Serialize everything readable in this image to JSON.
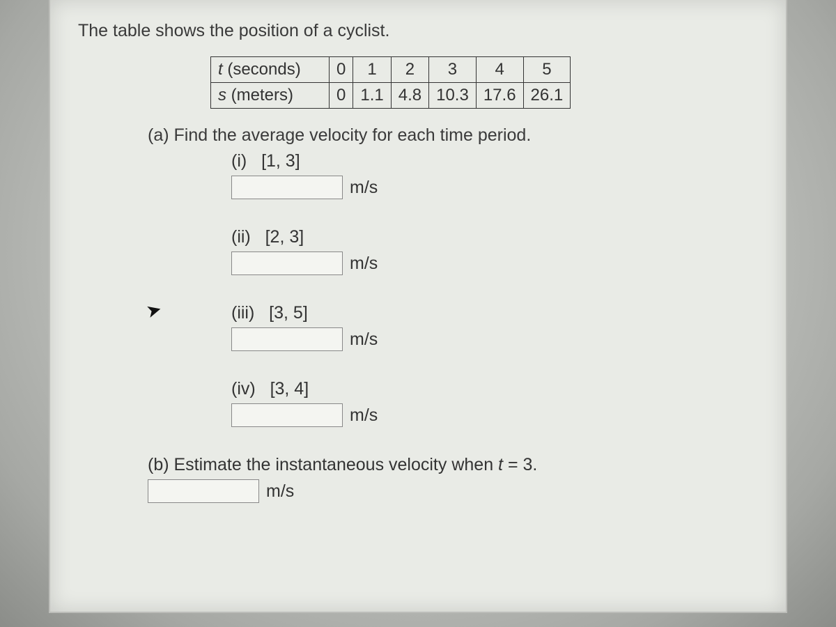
{
  "intro": "The table shows the position of a cyclist.",
  "table": {
    "row_t_label_var": "t",
    "row_t_label_rest": " (seconds)",
    "row_s_label_var": "s",
    "row_s_label_rest": " (meters)",
    "t_values": [
      "0",
      "1",
      "2",
      "3",
      "4",
      "5"
    ],
    "s_values": [
      "0",
      "1.1",
      "4.8",
      "10.3",
      "17.6",
      "26.1"
    ]
  },
  "part_a": {
    "prompt": "(a) Find the average velocity for each time period.",
    "items": [
      {
        "num": "(i)",
        "interval": "[1, 3]",
        "unit": "m/s"
      },
      {
        "num": "(ii)",
        "interval": "[2, 3]",
        "unit": "m/s"
      },
      {
        "num": "(iii)",
        "interval": "[3, 5]",
        "unit": "m/s"
      },
      {
        "num": "(iv)",
        "interval": "[3, 4]",
        "unit": "m/s"
      }
    ]
  },
  "part_b": {
    "prompt_pre": "(b) Estimate the instantaneous velocity when ",
    "prompt_var": "t",
    "prompt_post": " = 3.",
    "unit": "m/s"
  },
  "chart_data": {
    "type": "table",
    "columns": [
      "t (seconds)",
      "s (meters)"
    ],
    "rows": [
      [
        0,
        0
      ],
      [
        1,
        1.1
      ],
      [
        2,
        4.8
      ],
      [
        3,
        10.3
      ],
      [
        4,
        17.6
      ],
      [
        5,
        26.1
      ]
    ]
  }
}
